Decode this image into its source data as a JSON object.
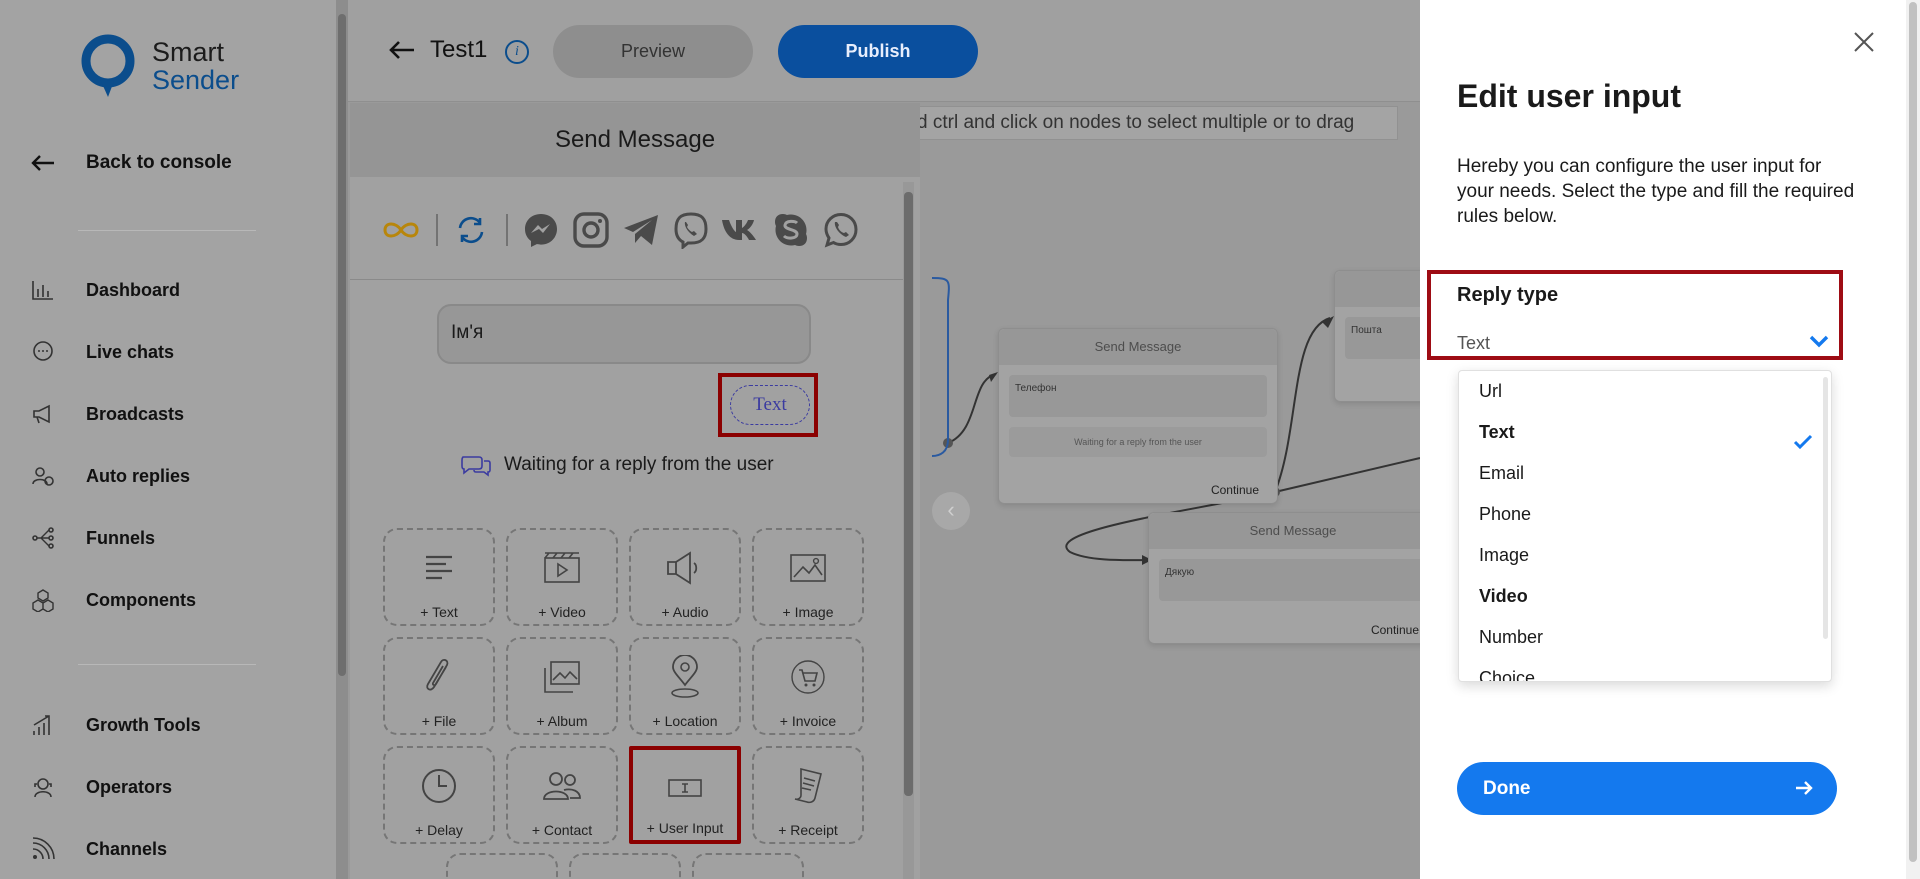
{
  "sidebar": {
    "logo": {
      "line1": "Smart",
      "line2": "Sender"
    },
    "back_label": "Back to console",
    "items_top": [
      {
        "label": "Dashboard",
        "icon": "bar-chart-icon"
      },
      {
        "label": "Live chats",
        "icon": "chat-bubble-icon"
      },
      {
        "label": "Broadcasts",
        "icon": "megaphone-icon"
      },
      {
        "label": "Auto replies",
        "icon": "auto-reply-icon"
      },
      {
        "label": "Funnels",
        "icon": "funnel-icon"
      },
      {
        "label": "Components",
        "icon": "cubes-icon"
      }
    ],
    "items_bottom": [
      {
        "label": "Growth Tools",
        "icon": "growth-icon"
      },
      {
        "label": "Operators",
        "icon": "operator-icon"
      },
      {
        "label": "Channels",
        "icon": "rss-icon"
      }
    ]
  },
  "topbar": {
    "flow_title": "Test1",
    "info_glyph": "i",
    "preview_label": "Preview",
    "publish_label": "Publish",
    "hint": "d ctrl and click on nodes to select multiple or to drag"
  },
  "canvas": {
    "nav_glyph": "‹",
    "nodes": [
      {
        "title": "Send Message",
        "body": "Телефон",
        "waiting": "Waiting for a reply from the user",
        "continue": "Continue"
      },
      {
        "title": "Send Message",
        "body": "Дякую",
        "continue": "Continue"
      },
      {
        "title": "",
        "body": "Пошта"
      }
    ]
  },
  "send_message": {
    "header": "Send Message",
    "message_text": "Ім'я",
    "reply_tag": "Text",
    "waiting_label": "Waiting for a reply from the user",
    "tiles": [
      {
        "label": "+ Text",
        "icon": "text-lines-icon"
      },
      {
        "label": "+ Video",
        "icon": "video-icon"
      },
      {
        "label": "+ Audio",
        "icon": "audio-icon"
      },
      {
        "label": "+ Image",
        "icon": "image-icon"
      },
      {
        "label": "+ File",
        "icon": "paperclip-icon"
      },
      {
        "label": "+ Album",
        "icon": "album-icon"
      },
      {
        "label": "+ Location",
        "icon": "location-pin-icon"
      },
      {
        "label": "+ Invoice",
        "icon": "cart-icon"
      },
      {
        "label": "+ Delay",
        "icon": "clock-icon"
      },
      {
        "label": "+ Contact",
        "icon": "contact-icon"
      },
      {
        "label": "+ User Input",
        "icon": "user-input-icon"
      },
      {
        "label": "+ Receipt",
        "icon": "receipt-icon"
      }
    ],
    "channels": [
      "infinity-icon",
      "refresh-icon",
      "messenger-icon",
      "instagram-icon",
      "telegram-icon",
      "viber-icon",
      "vk-icon",
      "skype-icon",
      "whatsapp-icon"
    ]
  },
  "edit_panel": {
    "title": "Edit user input",
    "description": "Hereby you can configure the user input for your needs. Select the type and fill the required rules below.",
    "reply_type_label": "Reply type",
    "reply_type_value": "Text",
    "options": [
      {
        "label": "Url"
      },
      {
        "label": "Text"
      },
      {
        "label": "Email"
      },
      {
        "label": "Phone"
      },
      {
        "label": "Image"
      },
      {
        "label": "Video"
      },
      {
        "label": "Number"
      },
      {
        "label": "Choice"
      }
    ],
    "done_label": "Done"
  },
  "colors": {
    "accent": "#1479ee",
    "highlight": "#9e0c14",
    "publish": "#0a4f9e"
  }
}
